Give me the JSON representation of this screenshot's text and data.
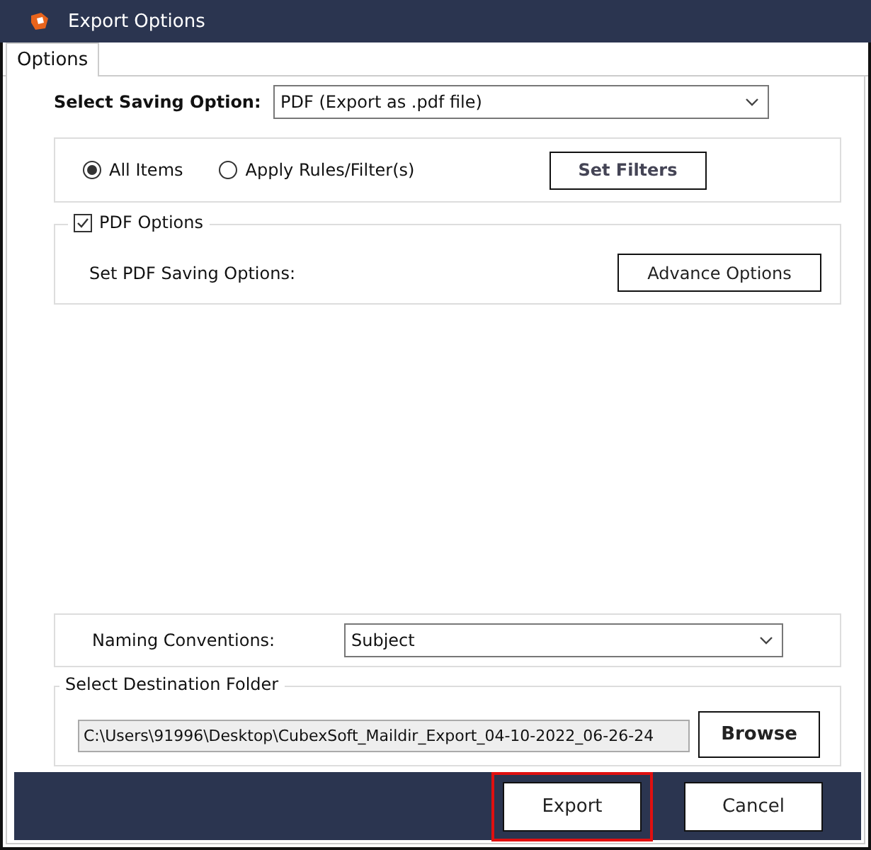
{
  "window": {
    "title": "Export Options"
  },
  "tabs": [
    {
      "label": "Options",
      "selected": true
    }
  ],
  "saving_option": {
    "label": "Select Saving Option:",
    "value": "PDF (Export as .pdf file)"
  },
  "scope": {
    "options": [
      {
        "label": "All Items",
        "selected": true
      },
      {
        "label": "Apply Rules/Filter(s)",
        "selected": false
      }
    ],
    "button": "Set Filters"
  },
  "pdf_options": {
    "label": "PDF Options",
    "checked": true,
    "text": "Set PDF Saving Options:",
    "button": "Advance Options"
  },
  "naming": {
    "label": "Naming Conventions:",
    "value": "Subject"
  },
  "destination": {
    "label": "Select Destination Folder",
    "path": "C:\\Users\\91996\\Desktop\\CubexSoft_Maildir_Export_04-10-2022_06-26-24",
    "button": "Browse"
  },
  "footer_buttons": [
    {
      "label": "Export",
      "highlighted": true
    },
    {
      "label": "Cancel",
      "highlighted": false
    }
  ]
}
